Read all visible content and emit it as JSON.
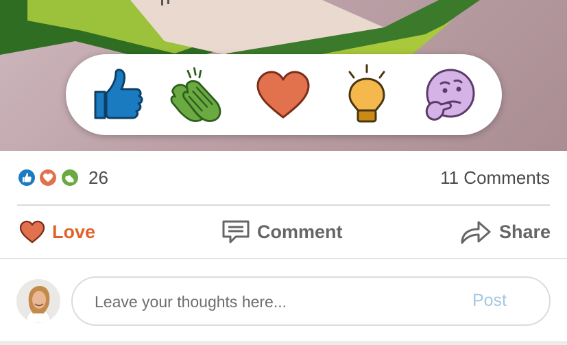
{
  "reactions": {
    "items": [
      {
        "id": "like",
        "icon": "thumbs-up-icon",
        "color": "#1b7bc0"
      },
      {
        "id": "celebrate",
        "icon": "clapping-hands-icon",
        "color": "#6aaa41"
      },
      {
        "id": "love",
        "icon": "heart-icon",
        "color": "#e2714e"
      },
      {
        "id": "insightful",
        "icon": "lightbulb-icon",
        "color": "#f5b84c"
      },
      {
        "id": "curious",
        "icon": "thinking-face-icon",
        "color": "#d6b3e6"
      }
    ]
  },
  "stats": {
    "reaction_count": "26",
    "comments_label": "11 Comments",
    "mini_icons": [
      "thumbs-up-icon",
      "heart-icon",
      "clapping-hands-icon"
    ]
  },
  "actions": {
    "love_label": "Love",
    "comment_label": "Comment",
    "share_label": "Share"
  },
  "composer": {
    "placeholder": "Leave your thoughts here...",
    "post_label": "Post"
  },
  "colors": {
    "love_accent": "#e0622a",
    "post_disabled": "#a4c8e1",
    "text_gray": "#666666"
  }
}
